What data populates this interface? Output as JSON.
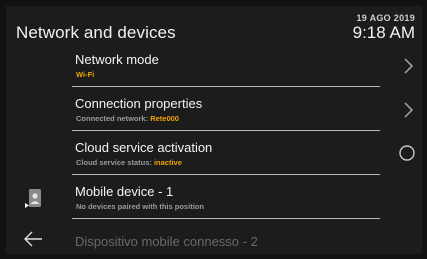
{
  "header": {
    "title": "Network and devices",
    "date": "19 AGO 2019",
    "time": "9:18 AM"
  },
  "rows": [
    {
      "title": "Network mode",
      "sub_label": "",
      "sub_value": "Wi-Fi",
      "control": "chevron-right-icon"
    },
    {
      "title": "Connection properties",
      "sub_label": "Connected network: ",
      "sub_value": "Rete000",
      "control": "chevron-right-icon"
    },
    {
      "title": "Cloud service activation",
      "sub_label": "Cloud service status: ",
      "sub_value": "inactive",
      "control": "radio-circle-icon"
    },
    {
      "title": "Mobile device - 1",
      "sub_label": "No devices paired with this position",
      "sub_value": "",
      "control": "none"
    },
    {
      "title": "Dispositivo mobile connesso - 2",
      "sub_label": "",
      "sub_value": "",
      "control": "none"
    }
  ],
  "side_icons": [
    "mobile-device-icon",
    "back-arrow-icon"
  ],
  "colors": {
    "background": "#1c1c1c",
    "accent": "#f0a400",
    "divider": "#b9b9b9",
    "subtext": "#9a9a9a"
  }
}
